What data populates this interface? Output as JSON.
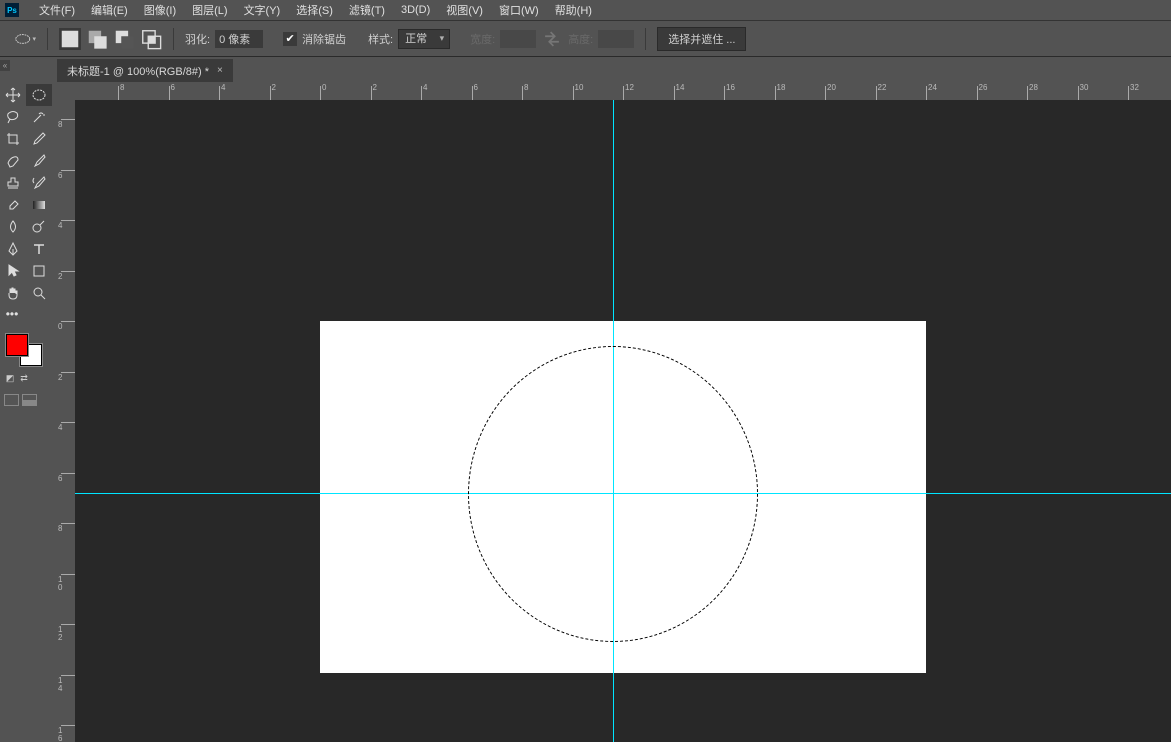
{
  "app": {
    "short": "Ps"
  },
  "menu": [
    "文件(F)",
    "编辑(E)",
    "图像(I)",
    "图层(L)",
    "文字(Y)",
    "选择(S)",
    "滤镜(T)",
    "3D(D)",
    "视图(V)",
    "窗口(W)",
    "帮助(H)"
  ],
  "options": {
    "feather_label": "羽化:",
    "feather_value": "0 像素",
    "antialias_label": "消除锯齿",
    "style_label": "样式:",
    "style_value": "正常",
    "width_label": "宽度:",
    "height_label": "高度:",
    "select_mask_btn": "选择并遮住 ..."
  },
  "tab": {
    "title": "未标题-1 @ 100%(RGB/8#) *"
  },
  "ruler_h": [
    "8",
    "6",
    "4",
    "2",
    "0",
    "2",
    "4",
    "6",
    "8",
    "10",
    "12",
    "14",
    "16",
    "18",
    "20",
    "22",
    "24",
    "26",
    "28",
    "30",
    "32"
  ],
  "ruler_v": [
    "8",
    "6",
    "4",
    "2",
    "0",
    "2",
    "4",
    "6",
    "8",
    "10",
    "12",
    "14",
    "16"
  ],
  "colors": {
    "fg": "#ff0000",
    "bg": "#ffffff",
    "guide": "#00e5ff"
  }
}
